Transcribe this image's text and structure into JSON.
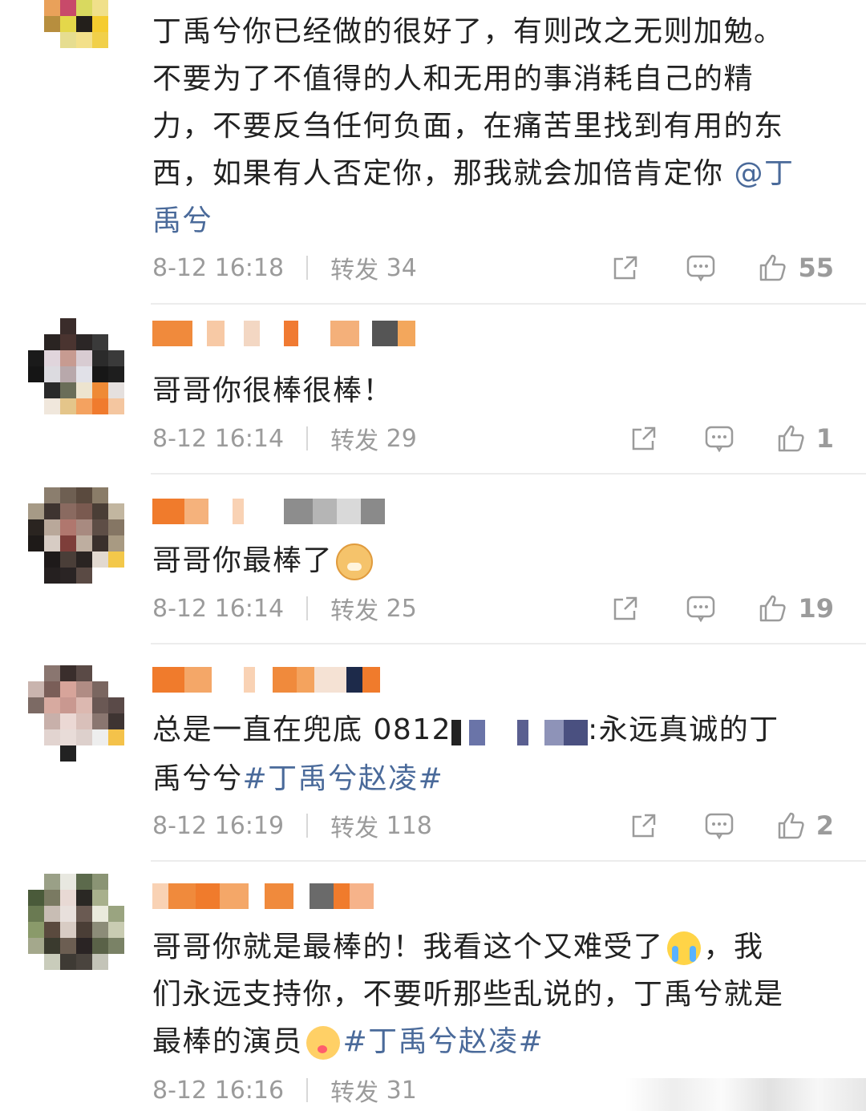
{
  "comments": [
    {
      "text_lines": [
        "丁禹兮你已经做的很好了，有则改之无则加勉。",
        "不要为了不值得的人和无用的事消耗自己的精",
        "力，不要反刍任何负面，在痛苦里找到有用的东",
        "西，如果有人否定你，那我就会加倍肯定你 "
      ],
      "mention": "@丁",
      "mention_tail": "禹兮",
      "date": "8-12 16:18",
      "repost_label": "转发",
      "repost_count": "34",
      "likes": "55"
    },
    {
      "text": "哥哥你很棒很棒！",
      "date": "8-12 16:14",
      "repost_label": "转发",
      "repost_count": "29",
      "likes": "1"
    },
    {
      "text": "哥哥你最棒了",
      "emoji": "dog-emoji",
      "date": "8-12 16:14",
      "repost_label": "转发",
      "repost_count": "25",
      "likes": "19"
    },
    {
      "text_prefix": "总是一直在兜底 0812",
      "text_suffix": ":永远真诚的丁",
      "text_line2": "禹兮兮",
      "hashtag": "#丁禹兮赵凌#",
      "date": "8-12 16:19",
      "repost_label": "转发",
      "repost_count": "118",
      "likes": "2"
    },
    {
      "line1a": "哥哥你就是最棒的！我看这个又难受了",
      "line1b": "，我",
      "line2": "们永远支持你，不要听那些乱说的，丁禹兮就是",
      "line3": "最棒的演员",
      "hashtag": "#丁禹兮赵凌#",
      "date": "8-12 16:16",
      "repost_label": "转发",
      "repost_count": "31"
    }
  ],
  "icons": [
    "share-icon",
    "comment-icon",
    "like-icon",
    "crying-emoji",
    "blush-emoji",
    "dog-emoji"
  ],
  "colors": {
    "link": "#4a6a9a",
    "meta": "#9b9b9b",
    "divider": "#ececec"
  }
}
